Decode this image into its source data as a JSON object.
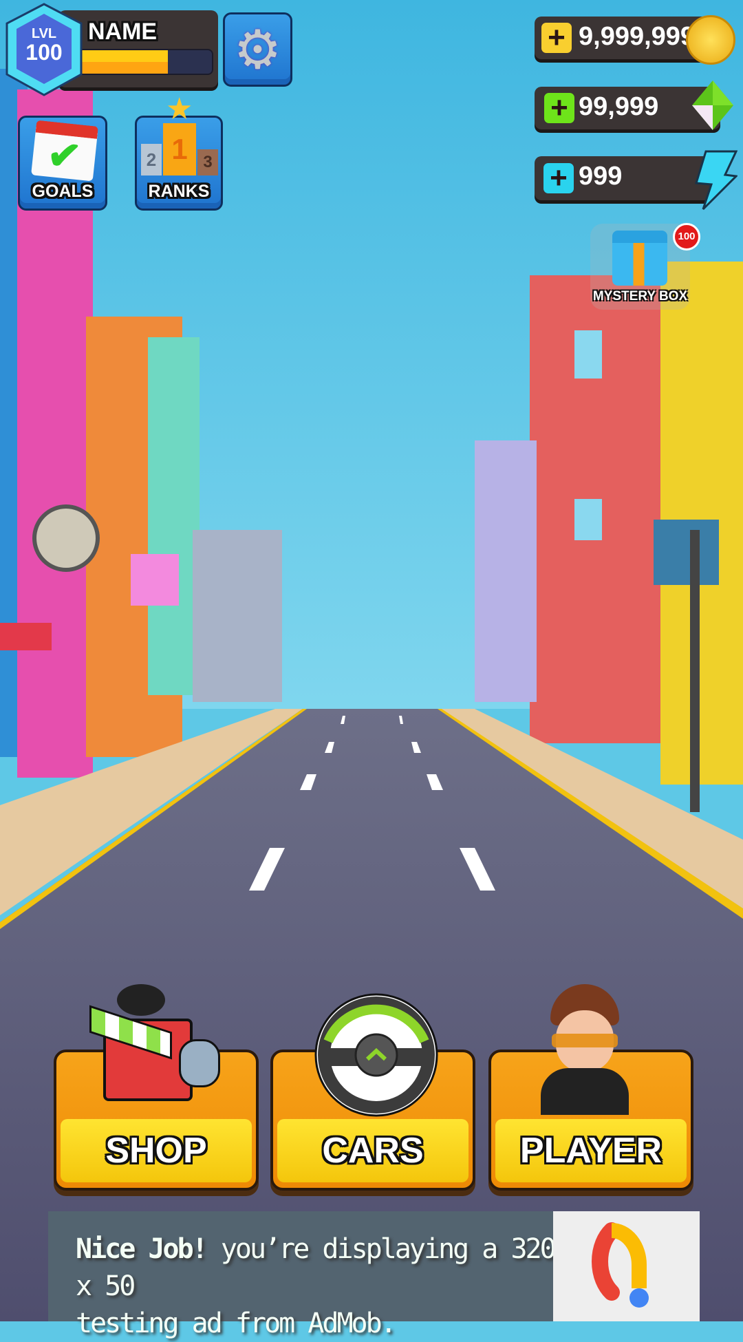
{
  "player": {
    "level_label": "LVL",
    "level": "100",
    "name": "NAME",
    "xp_progress": 0.67
  },
  "buttons": {
    "goals": "GOALS",
    "ranks": "RANKS",
    "settings_icon": "gear-icon"
  },
  "currencies": [
    {
      "id": "coins",
      "value": "9,999,999",
      "color": "#f9cf2f",
      "icon": "coin-icon"
    },
    {
      "id": "gems",
      "value": "99,999",
      "color": "#6ee41a",
      "icon": "gem-icon"
    },
    {
      "id": "energy",
      "value": "999",
      "color": "#2ad3ee",
      "icon": "lightning-icon"
    }
  ],
  "mystery_box": {
    "label": "MYSTERY BOX",
    "badge": "100"
  },
  "menu": {
    "shop": "SHOP",
    "cars": "CARS",
    "player": "PLAYER"
  },
  "ad": {
    "bold": "Nice Job!",
    "text_line1": " you’re displaying a 320 x 50",
    "text_line2": "testing ad from AdMob."
  }
}
